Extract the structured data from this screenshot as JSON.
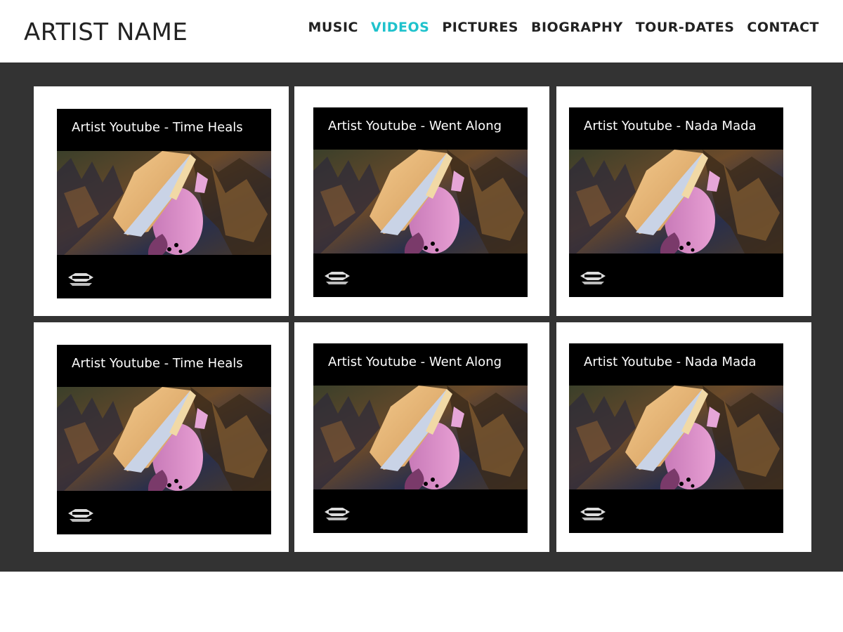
{
  "header": {
    "brand": "ARTIST NAME",
    "nav": [
      {
        "label": "MUSIC",
        "active": false
      },
      {
        "label": "VIDEOS",
        "active": true
      },
      {
        "label": "PICTURES",
        "active": false
      },
      {
        "label": "BIOGRAPHY",
        "active": false
      },
      {
        "label": "TOUR-DATES",
        "active": false
      },
      {
        "label": "CONTACT",
        "active": false
      }
    ]
  },
  "colors": {
    "accent": "#1fc2cc",
    "stage_background": "#333333",
    "text": "#222222"
  },
  "videos": [
    {
      "title": "Artist Youtube - Time Heals"
    },
    {
      "title": "Artist Youtube - Went Along"
    },
    {
      "title": "Artist Youtube - Nada Mada"
    },
    {
      "title": "Artist Youtube - Time Heals"
    },
    {
      "title": "Artist Youtube - Went Along"
    },
    {
      "title": "Artist Youtube - Nada Mada"
    }
  ]
}
